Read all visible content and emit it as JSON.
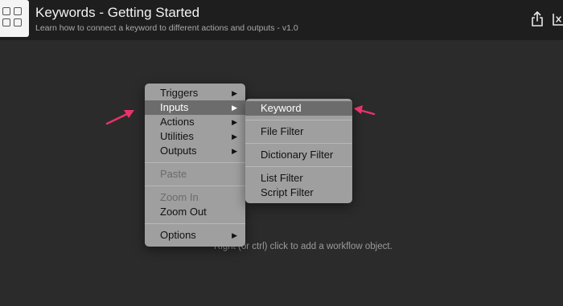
{
  "header": {
    "title": "Keywords - Getting Started",
    "subtitle": "Learn how to connect a keyword to different actions and outputs - v1.0"
  },
  "canvas": {
    "hint": "Right (or ctrl) click to add a workflow object."
  },
  "context_menu": {
    "items": [
      {
        "label": "Triggers",
        "submenu": true,
        "state": "normal"
      },
      {
        "label": "Inputs",
        "submenu": true,
        "state": "highlighted"
      },
      {
        "label": "Actions",
        "submenu": true,
        "state": "normal"
      },
      {
        "label": "Utilities",
        "submenu": true,
        "state": "normal"
      },
      {
        "label": "Outputs",
        "submenu": true,
        "state": "normal"
      },
      {
        "label": "Paste",
        "submenu": false,
        "state": "disabled"
      },
      {
        "label": "Zoom In",
        "submenu": false,
        "state": "disabled"
      },
      {
        "label": "Zoom Out",
        "submenu": false,
        "state": "normal"
      },
      {
        "label": "Options",
        "submenu": true,
        "state": "normal"
      }
    ],
    "submenu_arrow": "▶"
  },
  "inputs_submenu": {
    "items": [
      {
        "label": "Keyword",
        "state": "highlighted"
      },
      {
        "label": "File Filter",
        "state": "normal"
      },
      {
        "label": "Dictionary Filter",
        "state": "normal"
      },
      {
        "label": "List Filter",
        "state": "normal"
      },
      {
        "label": "Script Filter",
        "state": "normal"
      }
    ]
  },
  "colors": {
    "annotation_arrow": "#e8336b",
    "menu_bg": "#9f9f9f",
    "menu_highlight": "#6c6c6c"
  },
  "icons": [
    "workflow-grid-icon",
    "share-icon",
    "window-icon",
    "annotation-arrow-icon"
  ]
}
